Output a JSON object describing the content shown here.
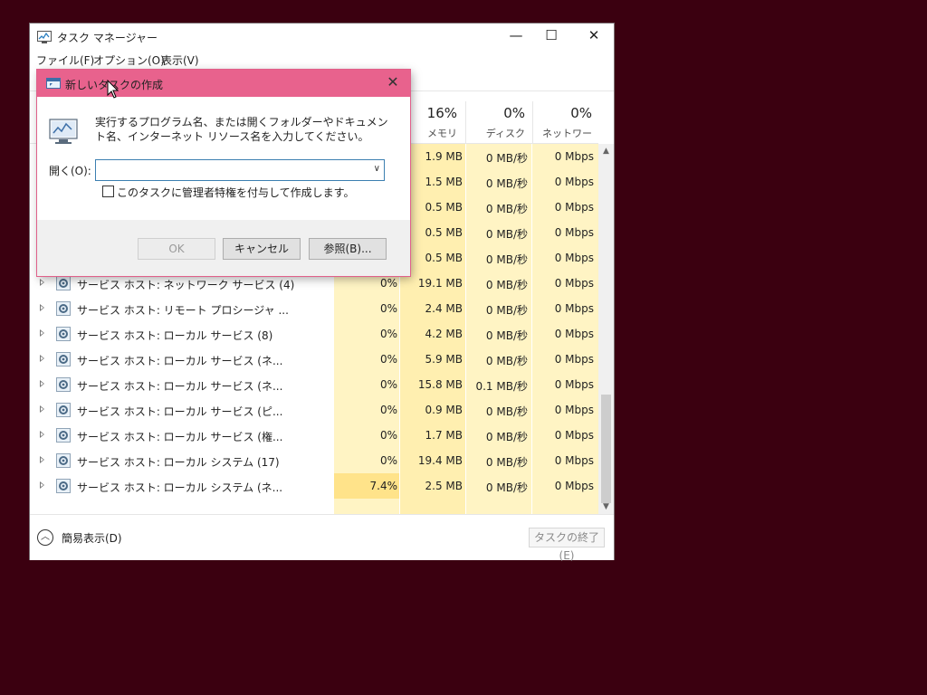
{
  "window": {
    "title": "タスク マネージャー",
    "menu": [
      "ファイル(F)",
      "オプション(O)",
      "表示(V)"
    ],
    "controls": {
      "minimize": "—",
      "maximize": "☐",
      "close": "✕"
    }
  },
  "columns": {
    "memory": {
      "pct": "16%",
      "label": "メモリ"
    },
    "disk": {
      "pct": "0%",
      "label": "ディスク"
    },
    "network": {
      "pct": "0%",
      "label": "ネットワーク"
    }
  },
  "top_rows": [
    {
      "mem": "1.9 MB",
      "disk": "0 MB/秒",
      "net": "0 Mbps"
    },
    {
      "mem": "1.5 MB",
      "disk": "0 MB/秒",
      "net": "0 Mbps"
    },
    {
      "mem": "0.5 MB",
      "disk": "0 MB/秒",
      "net": "0 Mbps"
    },
    {
      "mem": "0.5 MB",
      "disk": "0 MB/秒",
      "net": "0 Mbps"
    },
    {
      "mem": "0.5 MB",
      "disk": "0 MB/秒",
      "net": "0 Mbps"
    }
  ],
  "processes": [
    {
      "name": "サービス ホスト: ネットワーク サービス (4)",
      "cpu": "0%",
      "mem": "19.1 MB",
      "disk": "0 MB/秒",
      "net": "0 Mbps"
    },
    {
      "name": "サービス ホスト: リモート プロシージャ ...",
      "cpu": "0%",
      "mem": "2.4 MB",
      "disk": "0 MB/秒",
      "net": "0 Mbps"
    },
    {
      "name": "サービス ホスト: ローカル サービス (8)",
      "cpu": "0%",
      "mem": "4.2 MB",
      "disk": "0 MB/秒",
      "net": "0 Mbps"
    },
    {
      "name": "サービス ホスト: ローカル サービス (ネ...",
      "cpu": "0%",
      "mem": "5.9 MB",
      "disk": "0 MB/秒",
      "net": "0 Mbps"
    },
    {
      "name": "サービス ホスト: ローカル サービス (ネ...",
      "cpu": "0%",
      "mem": "15.8 MB",
      "disk": "0.1 MB/秒",
      "net": "0 Mbps"
    },
    {
      "name": "サービス ホスト: ローカル サービス (ピ...",
      "cpu": "0%",
      "mem": "0.9 MB",
      "disk": "0 MB/秒",
      "net": "0 Mbps"
    },
    {
      "name": "サービス ホスト: ローカル サービス (権...",
      "cpu": "0%",
      "mem": "1.7 MB",
      "disk": "0 MB/秒",
      "net": "0 Mbps"
    },
    {
      "name": "サービス ホスト: ローカル システム (17)",
      "cpu": "0%",
      "mem": "19.4 MB",
      "disk": "0 MB/秒",
      "net": "0 Mbps"
    },
    {
      "name": "サービス ホスト: ローカル システム (ネ...",
      "cpu": "7.4%",
      "mem": "2.5 MB",
      "disk": "0 MB/秒",
      "net": "0 Mbps"
    }
  ],
  "footer": {
    "simple_view": "簡易表示(D)",
    "end_task": "タスクの終了(E)"
  },
  "dialog": {
    "title": "新しいタスクの作成",
    "description": "実行するプログラム名、または開くフォルダーやドキュメント名、インターネット リソース名を入力してください。",
    "open_label": "開く(O):",
    "open_value": "",
    "admin_checkbox": "このタスクに管理者特権を付与して作成します。",
    "ok": "OK",
    "cancel": "キャンセル",
    "browse": "参照(B)..."
  },
  "colors": {
    "desktop": "#3b0010",
    "dialog_accent": "#e8628d",
    "heat_light": "#fff4c4",
    "heat_strong": "#ffe9a0"
  }
}
